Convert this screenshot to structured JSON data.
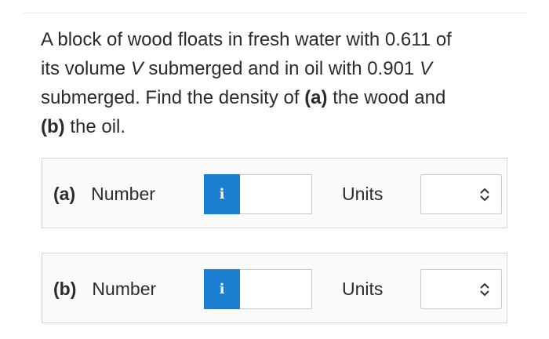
{
  "question": {
    "line1": "A block of wood floats in fresh water with 0.611 of",
    "line2_pre": "its volume ",
    "line2_var": "V",
    "line2_post": " submerged and in oil with 0.901 ",
    "line2_var2": "V",
    "line3_pre": "submerged. Find the density of ",
    "line3_a": "(a)",
    "line3_post": " the wood and",
    "line4_b": "(b)",
    "line4_post": " the oil."
  },
  "parts": [
    {
      "tag": "(a)",
      "number_label": "Number",
      "info_icon": "i",
      "value": "",
      "units_label": "Units",
      "units_value": ""
    },
    {
      "tag": "(b)",
      "number_label": "Number",
      "info_icon": "i",
      "value": "",
      "units_label": "Units",
      "units_value": ""
    }
  ],
  "colors": {
    "info_button": "#1a7fd0",
    "border": "#d5d5d5",
    "text": "#2b2b2b"
  }
}
